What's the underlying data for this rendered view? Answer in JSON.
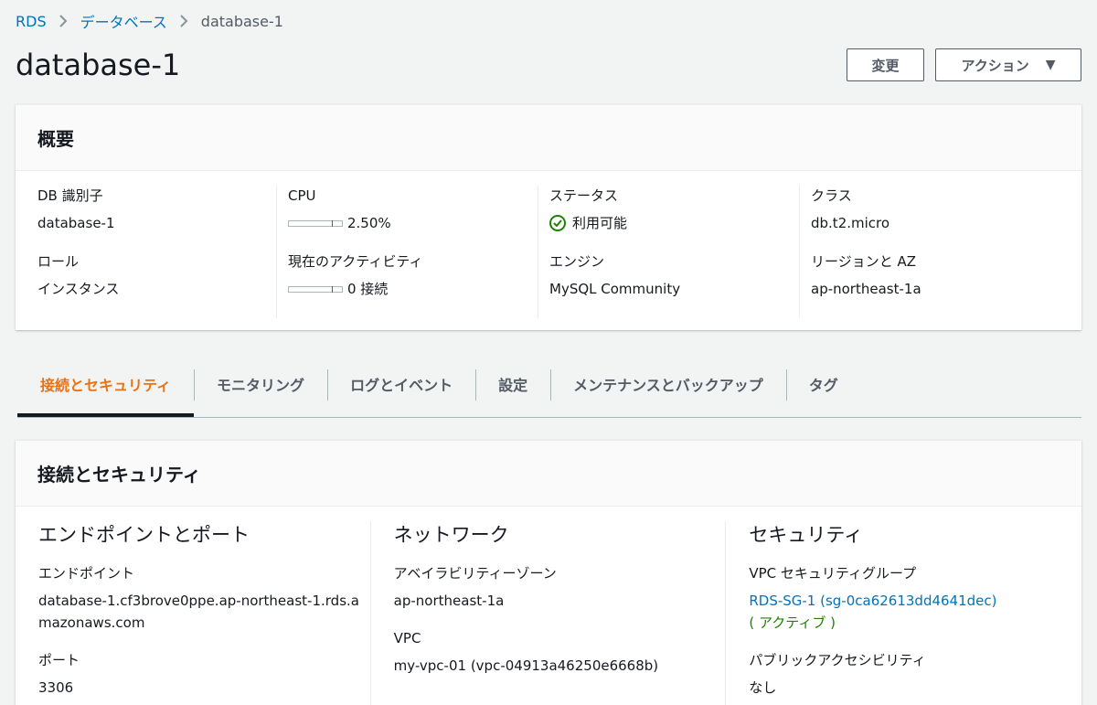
{
  "breadcrumb": {
    "root": "RDS",
    "parent": "データベース",
    "current": "database-1"
  },
  "page": {
    "title": "database-1"
  },
  "header_actions": {
    "modify_label": "変更",
    "actions_label": "アクション",
    "actions_caret": "▼"
  },
  "summary": {
    "title": "概要",
    "db_identifier": {
      "label": "DB 識別子",
      "value": "database-1"
    },
    "role": {
      "label": "ロール",
      "value": "インスタンス"
    },
    "cpu": {
      "label": "CPU",
      "value": "2.50%",
      "fraction": 0.025
    },
    "activity": {
      "label": "現在のアクティビティ",
      "value": "0 接続"
    },
    "status": {
      "label": "ステータス",
      "value": "利用可能",
      "color": "#1d8102"
    },
    "engine": {
      "label": "エンジン",
      "value": "MySQL Community"
    },
    "class": {
      "label": "クラス",
      "value": "db.t2.micro"
    },
    "region_az": {
      "label": "リージョンと AZ",
      "value": "ap-northeast-1a"
    }
  },
  "tabs": [
    {
      "label": "接続とセキュリティ",
      "active": true
    },
    {
      "label": "モニタリング"
    },
    {
      "label": "ログとイベント"
    },
    {
      "label": "設定"
    },
    {
      "label": "メンテナンスとバックアップ"
    },
    {
      "label": "タグ"
    }
  ],
  "connectivity": {
    "title": "接続とセキュリティ",
    "endpoint_port": {
      "heading": "エンドポイントとポート",
      "endpoint_label": "エンドポイント",
      "endpoint_value": "database-1.cf3brove0ppe.ap-northeast-1.rds.amazonaws.com",
      "port_label": "ポート",
      "port_value": "3306"
    },
    "network": {
      "heading": "ネットワーク",
      "az_label": "アベイラビリティーゾーン",
      "az_value": "ap-northeast-1a",
      "vpc_label": "VPC",
      "vpc_value": "my-vpc-01 (vpc-04913a46250e6668b)"
    },
    "security": {
      "heading": "セキュリティ",
      "sg_label": "VPC セキュリティグループ",
      "sg_value": "RDS-SG-1 (sg-0ca62613dd4641dec)",
      "sg_status": "( アクティブ )",
      "public_label": "パブリックアクセシビリティ",
      "public_value": "なし"
    }
  },
  "colors": {
    "accent": "#ec7211",
    "link": "#0073bb",
    "ok": "#1d8102"
  }
}
